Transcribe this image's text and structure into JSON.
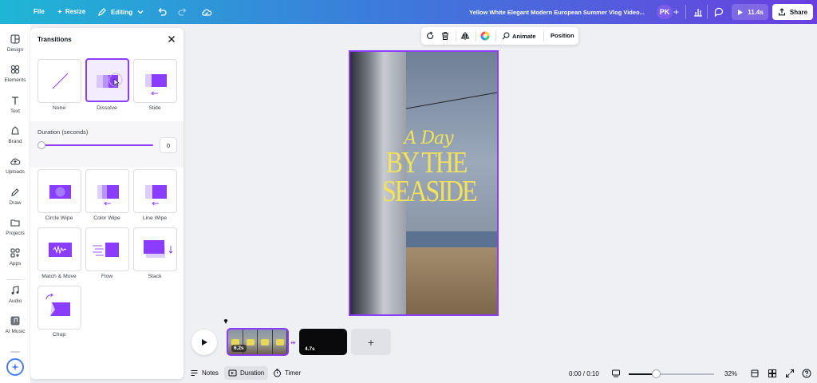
{
  "topbar": {
    "file": "File",
    "resize": "Resize",
    "editing": "Editing",
    "doc_title": "Yellow White Elegant Modern European Summer Vlog Video...",
    "avatar": "PK",
    "play_time": "11.4s",
    "share": "Share"
  },
  "rail": {
    "items": [
      {
        "label": "Design",
        "icon": "design-icon"
      },
      {
        "label": "Elements",
        "icon": "elements-icon"
      },
      {
        "label": "Text",
        "icon": "text-icon"
      },
      {
        "label": "Brand",
        "icon": "brand-icon"
      },
      {
        "label": "Uploads",
        "icon": "uploads-icon"
      },
      {
        "label": "Draw",
        "icon": "draw-icon"
      },
      {
        "label": "Projects",
        "icon": "projects-icon"
      },
      {
        "label": "Apps",
        "icon": "apps-icon"
      },
      {
        "label": "Audio",
        "icon": "audio-icon"
      },
      {
        "label": "AI Music",
        "icon": "ai-music-icon"
      }
    ]
  },
  "panel": {
    "title": "Transitions",
    "top_tiles": [
      {
        "label": "None"
      },
      {
        "label": "Dissolve",
        "selected": true
      },
      {
        "label": "Slide"
      }
    ],
    "duration_label": "Duration (seconds)",
    "duration_value": "0",
    "duration_fraction": 0,
    "tiles": [
      {
        "label": "Circle Wipe"
      },
      {
        "label": "Color Wipe"
      },
      {
        "label": "Line Wipe"
      },
      {
        "label": "Match & Move"
      },
      {
        "label": "Flow"
      },
      {
        "label": "Stack"
      },
      {
        "label": "Chop"
      }
    ]
  },
  "context_toolbar": {
    "animate": "Animate",
    "position": "Position"
  },
  "canvas": {
    "line1": "A Day",
    "line2": "BY THE",
    "line3": "SEASIDE"
  },
  "timeline": {
    "clip1_duration": "6.2s",
    "clip2_duration": "4.7s",
    "add": "+"
  },
  "bottombar": {
    "notes": "Notes",
    "duration": "Duration",
    "timer": "Timer",
    "time": "0:00 / 0:10",
    "zoom": "32%",
    "zoom_fraction": 0.32
  },
  "colors": {
    "accent": "#8b3dff",
    "title_yellow": "#f4e25a"
  }
}
